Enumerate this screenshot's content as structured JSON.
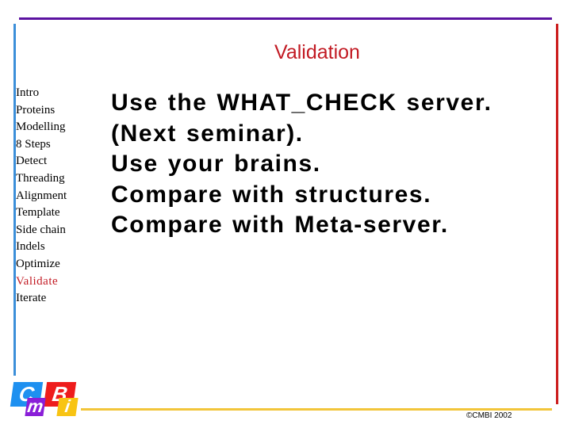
{
  "slide": {
    "title": "Validation",
    "colors": {
      "top_rule": "#5b12a0",
      "left_rule": "#3c8fd9",
      "right_rule": "#cc1d1d",
      "bottom_rule": "#f2c53a",
      "title": "#c21a23",
      "active_nav": "#c21a23"
    }
  },
  "sidebar": {
    "items": [
      {
        "label": "Intro",
        "active": false
      },
      {
        "label": "Proteins",
        "active": false
      },
      {
        "label": "Modelling",
        "active": false
      },
      {
        "label": "8 Steps",
        "active": false
      },
      {
        "label": "Detect",
        "active": false
      },
      {
        "label": "Threading",
        "active": false
      },
      {
        "label": "Alignment",
        "active": false
      },
      {
        "label": "Template",
        "active": false
      },
      {
        "label": "Side chain",
        "active": false
      },
      {
        "label": "Indels",
        "active": false
      },
      {
        "label": "Optimize",
        "active": false
      },
      {
        "label": "Validate",
        "active": true
      },
      {
        "label": "Iterate",
        "active": false
      }
    ]
  },
  "main": {
    "lines": [
      "Use the WHAT_CHECK server.",
      "(Next seminar).",
      "Use your brains.",
      "Compare with structures.",
      "Compare with Meta-server."
    ]
  },
  "logo": {
    "letters": [
      "C",
      "m",
      "B",
      "i"
    ]
  },
  "footer": {
    "copyright": "©CMBI 2002"
  }
}
